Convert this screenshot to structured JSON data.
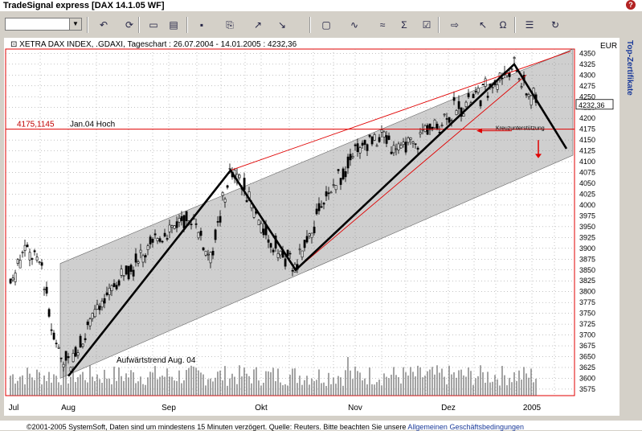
{
  "window": {
    "title": "TradeSignal express [DAX 14.1.05 WF]",
    "help_icon": "question-icon"
  },
  "toolbar": {
    "symbol_value": "",
    "buttons": [
      {
        "name": "undo-icon",
        "glyph": "↶"
      },
      {
        "name": "refresh-icon",
        "glyph": "⟳"
      },
      {
        "name": "new-icon",
        "glyph": "▭"
      },
      {
        "name": "open-icon",
        "glyph": "▤"
      },
      {
        "name": "save-icon",
        "glyph": "▪"
      },
      {
        "name": "copy-icon",
        "glyph": "⎘"
      },
      {
        "name": "chart-up-icon",
        "glyph": "↗"
      },
      {
        "name": "chart-down-icon",
        "glyph": "↘"
      },
      {
        "name": "window-icon",
        "glyph": "▢"
      },
      {
        "name": "studies-icon",
        "glyph": "∿"
      },
      {
        "name": "indicator-icon",
        "glyph": "≈"
      },
      {
        "name": "sum-icon",
        "glyph": "Σ"
      },
      {
        "name": "properties-icon",
        "glyph": "☑"
      },
      {
        "name": "arrow-right-icon",
        "glyph": "⇨"
      },
      {
        "name": "cursor-icon",
        "glyph": "↖"
      },
      {
        "name": "magnet-icon",
        "glyph": "Ω"
      },
      {
        "name": "list-icon",
        "glyph": "☰"
      },
      {
        "name": "reload-icon",
        "glyph": "↻"
      }
    ]
  },
  "side_panel": {
    "label": "Top-Zertifikate"
  },
  "chart": {
    "header": "XETRA DAX INDEX, .GDAXI, Tageschart : 26.07.2004 - 14.01.2005 : 4232,36",
    "currency": "EUR",
    "last_price_label": "4232,36",
    "resistance_value": "4175,1145",
    "resistance_label": "Jan.04 Hoch",
    "support_annotation": "Kreuzunterstützung",
    "trend_label": "Aufwärtstrend Aug. 04",
    "colors": {
      "candle": "#000000",
      "channel": "#cfcfcf",
      "red": "#e00000",
      "grid": "#888888"
    }
  },
  "chart_data": {
    "type": "candlestick",
    "title": "XETRA DAX INDEX, .GDAXI, Tageschart : 26.07.2004 - 14.01.2005 : 4232,36",
    "y_ticks": [
      3575,
      3600,
      3625,
      3650,
      3675,
      3700,
      3725,
      3750,
      3775,
      3800,
      3825,
      3850,
      3875,
      3900,
      3925,
      3950,
      3975,
      4000,
      4025,
      4050,
      4075,
      4100,
      4125,
      4150,
      4175,
      4200,
      4225,
      4250,
      4275,
      4300,
      4325,
      4350
    ],
    "ylim": [
      3560,
      4360
    ],
    "x_labels": [
      "Jul",
      "Aug",
      "Sep",
      "Okt",
      "Nov",
      "Dez",
      "2005"
    ],
    "pivots": [
      {
        "date": "2004-08-06",
        "close": 3620
      },
      {
        "date": "2004-08-30",
        "close": 3780
      },
      {
        "date": "2004-09-27",
        "close": 4080
      },
      {
        "date": "2004-10-25",
        "close": 3850
      },
      {
        "date": "2004-12-29",
        "close": 4325
      },
      {
        "date": "2005-01-14",
        "close": 4232.36
      }
    ],
    "resistance": 4175.1145
  },
  "footer": {
    "text": "©2001-2005 SystemSoft, Daten sind um mindestens 15 Minuten verzögert. Quelle: Reuters. Bitte beachten Sie unsere ",
    "link": "Allgemeinen Geschäftsbedingungen"
  }
}
